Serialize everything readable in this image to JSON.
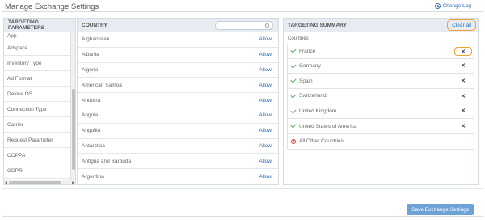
{
  "header": {
    "title": "Manage Exchange Settings",
    "change_log": "Change Log"
  },
  "params": {
    "title": "TARGETING PARAMETERS",
    "items": [
      "App",
      "Adspace",
      "Inventory Type",
      "Ad Format",
      "Device OS",
      "Connection Type",
      "Carrier",
      "Request Parameter",
      "COPPA",
      "GDPR"
    ]
  },
  "country": {
    "title": "COUNTRY",
    "search_placeholder": "",
    "allow_label": "Allow",
    "items": [
      "Afghanistan",
      "Albania",
      "Algeria",
      "American Samoa",
      "Andorra",
      "Angola",
      "Anguilla",
      "Antarctica",
      "Antigua and Barbuda",
      "Argentina"
    ]
  },
  "summary": {
    "title": "TARGETING SUMMARY",
    "clear_all": "Clear all",
    "countries_label": "Countries",
    "selected": [
      "France",
      "Germany",
      "Spain",
      "Switzerland",
      "United Kingdom",
      "United States of America"
    ],
    "remove_symbol": "✕",
    "excluded": "All Other Countries"
  },
  "footer": {
    "save_label": "Save Exchange Settings"
  },
  "colors": {
    "accent": "#2f6fb6",
    "highlight": "#f0a030",
    "check": "#4caf50",
    "block": "#e53935",
    "save_button": "#6ea2d6"
  }
}
